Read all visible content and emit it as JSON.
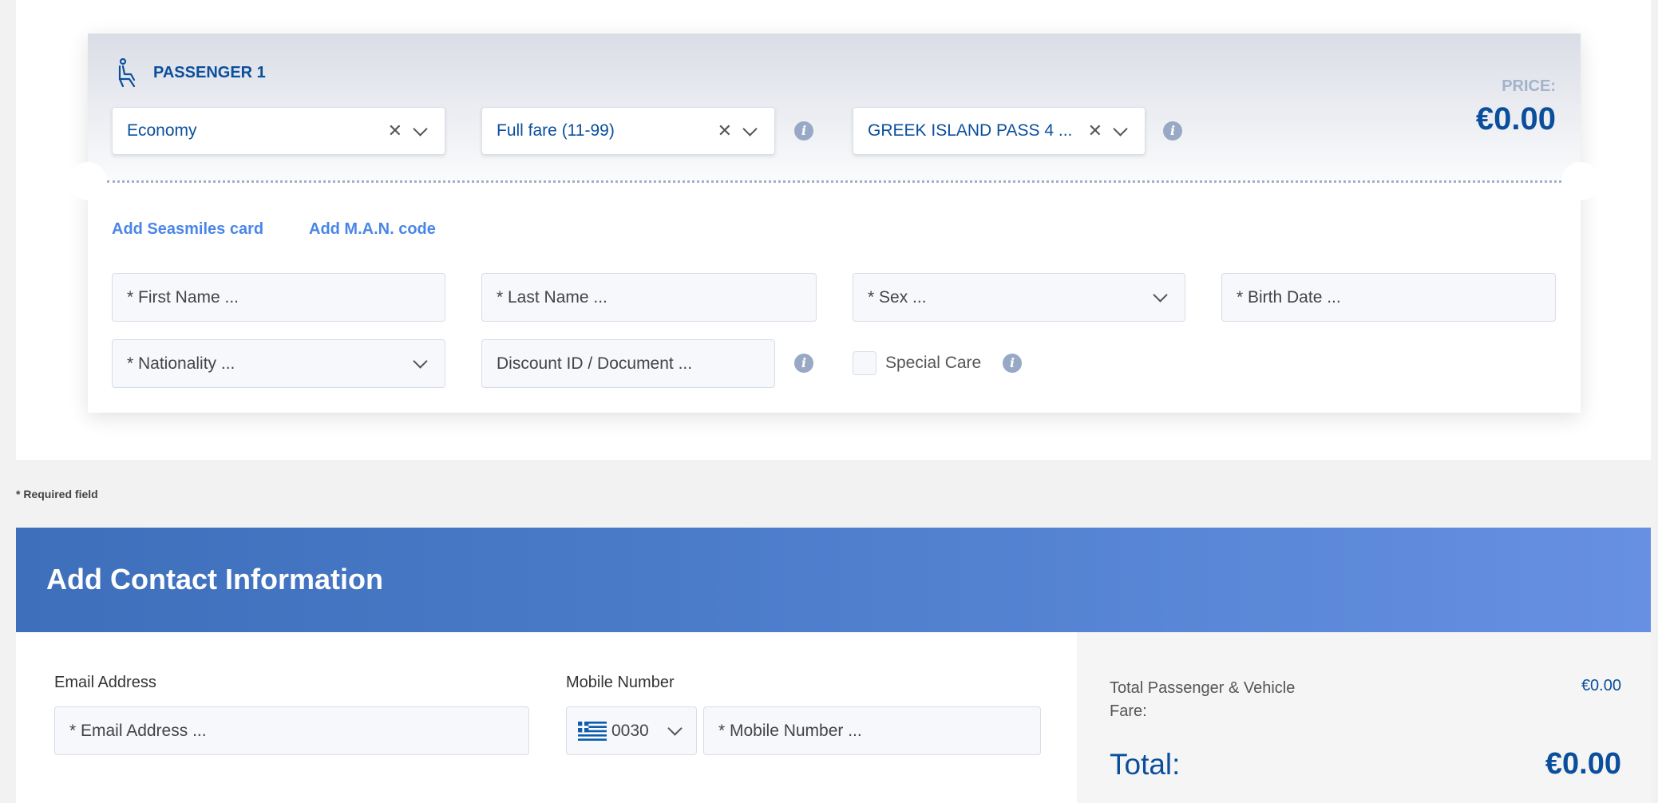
{
  "passenger": {
    "title": "PASSENGER 1",
    "class_select": "Economy",
    "fare_select": "Full fare (11-99)",
    "pass_select": "GREEK ISLAND PASS 4 ...",
    "price_label": "PRICE:",
    "price_value": "€0.00",
    "add_seasmiles": "Add Seasmiles card",
    "add_man": "Add M.A.N. code",
    "first_name_placeholder": "* First Name ...",
    "last_name_placeholder": "* Last Name ...",
    "sex_placeholder": "* Sex ...",
    "birth_date_placeholder": "* Birth Date ...",
    "nationality_placeholder": "* Nationality ...",
    "discount_placeholder": "Discount ID / Document ...",
    "special_care_label": "Special Care",
    "info_glyph": "i"
  },
  "required_note": "* Required field",
  "contact": {
    "title": "Add Contact Information",
    "email_label": "Email Address",
    "email_placeholder": "* Email Address ...",
    "mobile_label": "Mobile Number",
    "country_code": "0030",
    "mobile_placeholder": "* Mobile Number ..."
  },
  "summary": {
    "fare_label_line1": "Total Passenger & Vehicle",
    "fare_label_line2": "Fare:",
    "fare_value": "€0.00",
    "total_label": "Total:",
    "total_value": "€0.00"
  },
  "colors": {
    "brand": "#0b4f9c",
    "link": "#4a86e8",
    "banner": "#4a7bc9"
  }
}
